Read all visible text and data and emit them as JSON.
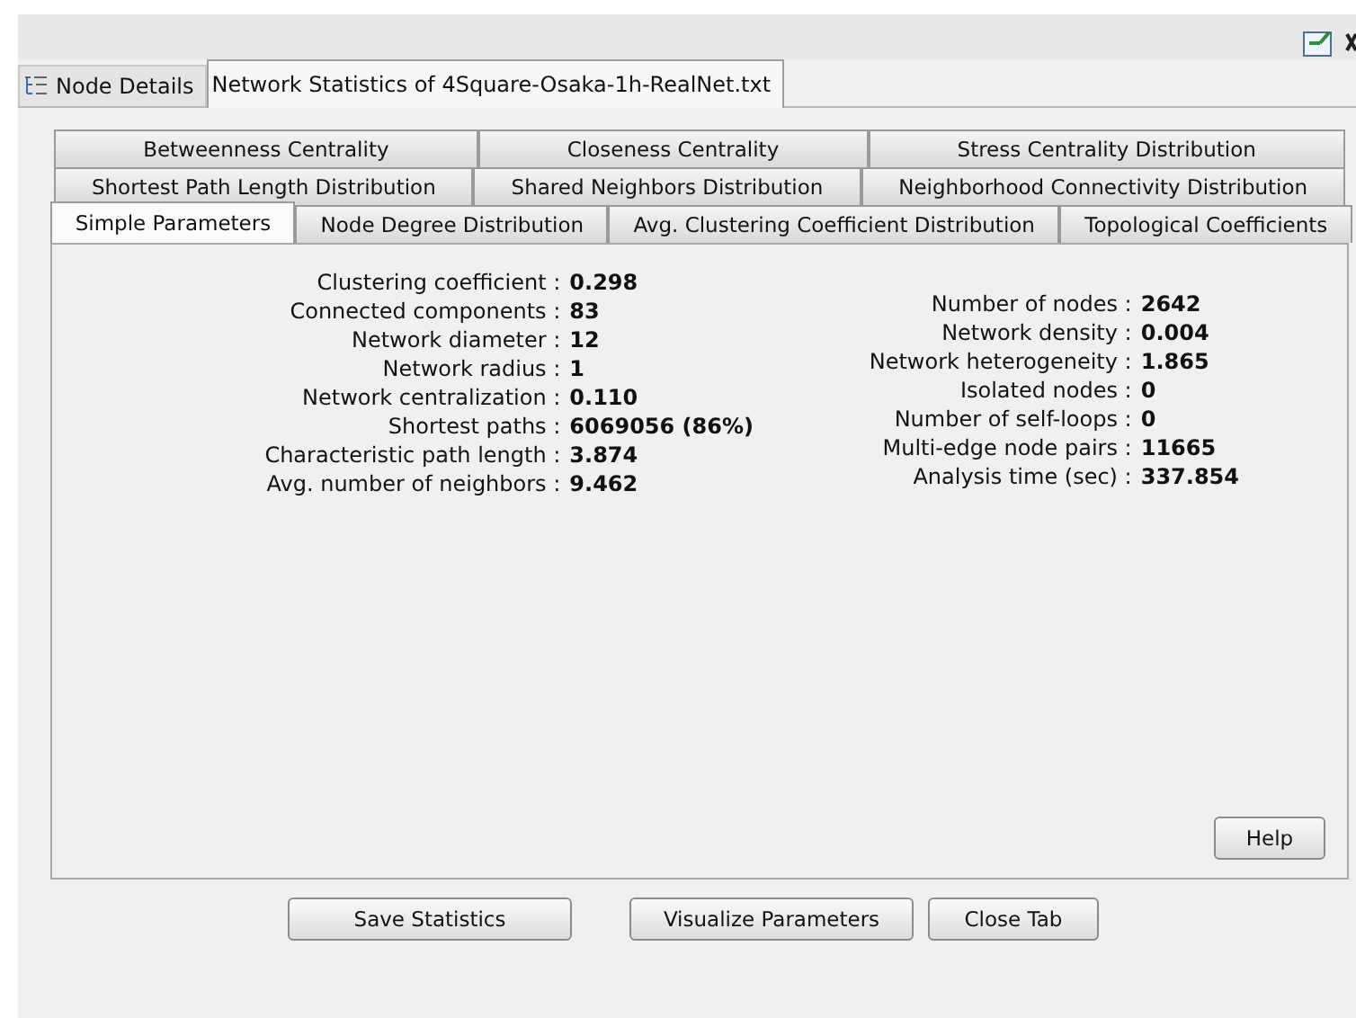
{
  "outer_tabs": [
    {
      "label": "Node Details",
      "selected": false,
      "kind": "tree"
    },
    {
      "label": "Network Statistics of 4Square-Osaka-1h-RealNet.txt",
      "selected": true,
      "kind": "plain"
    }
  ],
  "tab_rows": [
    [
      {
        "label": "Betweenness Centrality",
        "selected": false
      },
      {
        "label": "Closeness Centrality",
        "selected": false
      },
      {
        "label": "Stress Centrality Distribution",
        "selected": false
      }
    ],
    [
      {
        "label": "Shortest Path Length Distribution",
        "selected": false
      },
      {
        "label": "Shared Neighbors Distribution",
        "selected": false
      },
      {
        "label": "Neighborhood Connectivity Distribution",
        "selected": false
      }
    ],
    [
      {
        "label": "Simple Parameters",
        "selected": true
      },
      {
        "label": "Node Degree Distribution",
        "selected": false
      },
      {
        "label": "Avg. Clustering Coefficient Distribution",
        "selected": false
      },
      {
        "label": "Topological Coefficients",
        "selected": false
      }
    ]
  ],
  "left_stats": [
    {
      "label": "Clustering coefficient :",
      "value": "0.298"
    },
    {
      "label": "Connected components :",
      "value": "83"
    },
    {
      "label": "Network diameter :",
      "value": "12"
    },
    {
      "label": "Network radius :",
      "value": "1"
    },
    {
      "label": "Network centralization :",
      "value": "0.110"
    },
    {
      "label": "Shortest paths :",
      "value": "6069056 (86%)"
    },
    {
      "label": "Characteristic path length :",
      "value": "3.874"
    },
    {
      "label": "Avg. number of neighbors :",
      "value": "9.462"
    }
  ],
  "right_stats": [
    {
      "label": "Number of nodes :",
      "value": "2642"
    },
    {
      "label": "Network density :",
      "value": "0.004"
    },
    {
      "label": "Network heterogeneity :",
      "value": "1.865"
    },
    {
      "label": "Isolated nodes :",
      "value": "0"
    },
    {
      "label": "Number of self-loops :",
      "value": "0"
    },
    {
      "label": "Multi-edge node pairs :",
      "value": "11665"
    },
    {
      "label": "Analysis time (sec) :",
      "value": "337.854"
    }
  ],
  "help_button": "Help",
  "buttons": [
    "Save Statistics",
    "Visualize Parameters",
    "Close Tab"
  ]
}
